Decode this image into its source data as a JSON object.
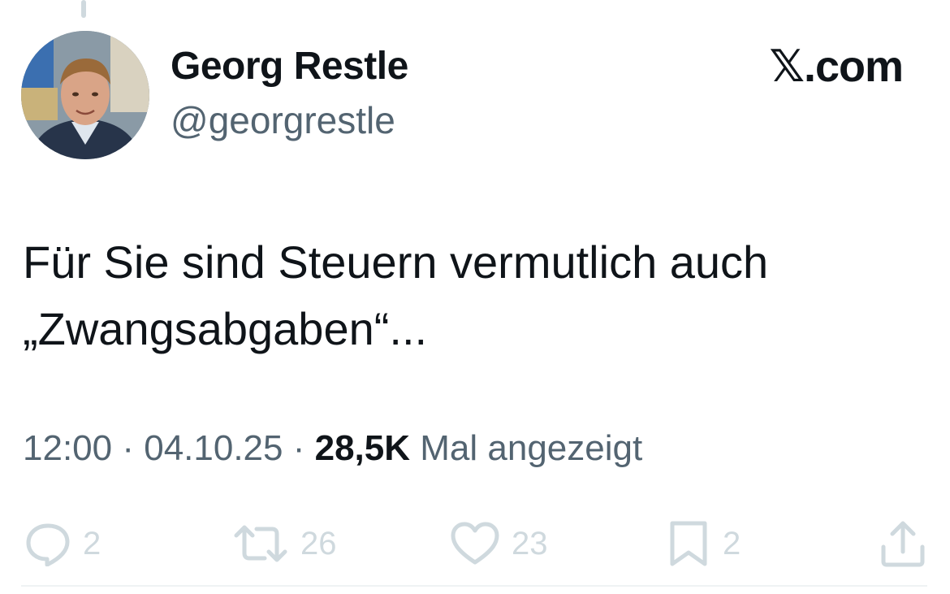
{
  "author": {
    "display_name": "Georg Restle",
    "handle": "@georgrestle"
  },
  "brand": "𝕏.com",
  "tweet": {
    "line1": "Für Sie sind Steuern vermutlich auch",
    "line2": "„Zwangsabgaben“..."
  },
  "meta": {
    "time": "12:00",
    "sep1": " · ",
    "date": "04.10.25",
    "sep2": " · ",
    "views_count": "28,5K",
    "views_label": " Mal angezeigt"
  },
  "actions": {
    "replies": "2",
    "reposts": "26",
    "likes": "23",
    "bookmarks": "2"
  },
  "icons": [
    "reply-icon",
    "repost-icon",
    "like-icon",
    "bookmark-icon",
    "share-icon"
  ],
  "colors": {
    "text": "#0f1419",
    "secondary": "#536471",
    "icon_faded": "#cfd9de"
  }
}
